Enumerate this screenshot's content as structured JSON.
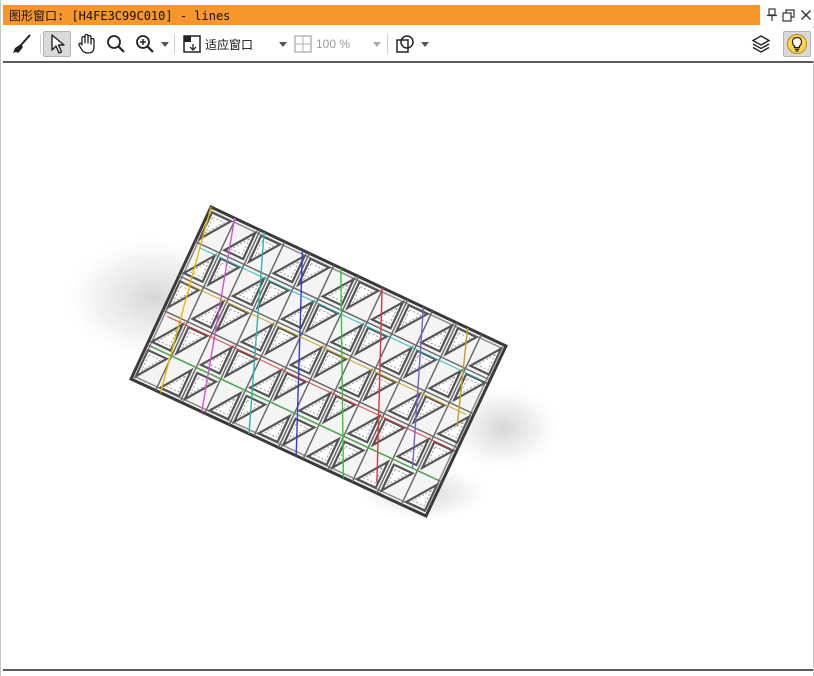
{
  "window": {
    "title": "图形窗口: [H4FE3C99C010] - lines"
  },
  "toolbar": {
    "fit_label": "适应窗口",
    "zoom_value": "100 %"
  },
  "icons": {
    "clear": "broom-icon",
    "pointer": "pointer-icon",
    "pan": "hand-icon",
    "zoom": "magnifier-icon",
    "zoom_in": "zoom-in-icon",
    "fit": "fit-window-icon",
    "zoom_mode": "zoom-mode-icon",
    "shapes": "shapes-icon",
    "layers": "layers-icon",
    "tips": "lightbulb-icon"
  },
  "colors": {
    "title_accent": "#f7962a",
    "tips_bg": "#ffd54a"
  }
}
